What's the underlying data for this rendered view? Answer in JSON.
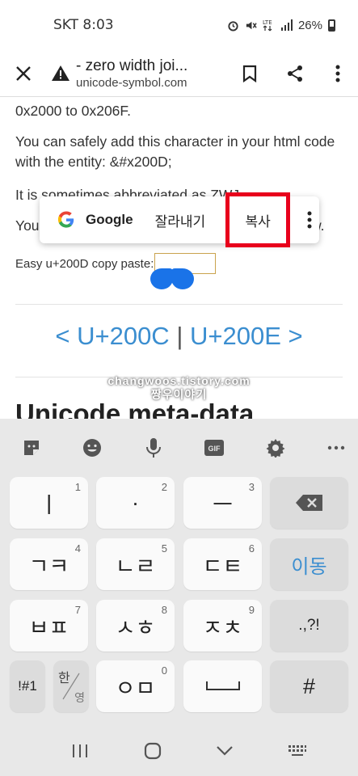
{
  "status_bar": {
    "carrier_time": "SKT 8:03",
    "battery_percent": "26%"
  },
  "toolbar": {
    "title": "- zero width joi...",
    "url": "unicode-symbol.com"
  },
  "page": {
    "range_text": "0x2000 to 0x206F.",
    "entity_text": "You can safely add this character in your html code with the entity: &#x200D;",
    "abbrev_text": "It is sometimes abbreviated as ZWJ",
    "you_text": "You",
    "w_text": "w.",
    "copy_paste_label": "Easy u+200D copy paste:",
    "prev_link": "<  U+200C",
    "nav_sep": "|",
    "next_link": "U+200E  >",
    "meta_heading": "Unicode meta-data"
  },
  "watermark": {
    "line1": "changwoos.tistory.com",
    "line2": "짱우이야기"
  },
  "selection_popup": {
    "google_label": "Google",
    "cut_label": "잘라내기",
    "copy_label": "복사",
    "highlight_color": "#e8001c"
  },
  "keyboard": {
    "tools": [
      "sticker-icon",
      "emoji-icon",
      "mic-icon",
      "gif-icon",
      "gear-icon",
      "more-icon"
    ],
    "gif_label": "GIF",
    "rows": [
      [
        {
          "label": "ㅣ",
          "num": "1"
        },
        {
          "label": "·",
          "num": "2"
        },
        {
          "label": "ㅡ",
          "num": "3"
        },
        {
          "label": "⌫",
          "num": ""
        }
      ],
      [
        {
          "label": "ㄱㅋ",
          "num": "4"
        },
        {
          "label": "ㄴㄹ",
          "num": "5"
        },
        {
          "label": "ㄷㅌ",
          "num": "6"
        },
        {
          "label": "이동",
          "num": ""
        }
      ],
      [
        {
          "label": "ㅂㅍ",
          "num": "7"
        },
        {
          "label": "ㅅㅎ",
          "num": "8"
        },
        {
          "label": "ㅈㅊ",
          "num": "9"
        },
        {
          "label": ".,?!",
          "num": ""
        }
      ],
      [
        {
          "label": "!#1",
          "num": ""
        },
        {
          "label": "한/영",
          "num": ""
        },
        {
          "label": "ㅇㅁ",
          "num": "0"
        },
        {
          "label": "⎵",
          "num": ""
        },
        {
          "label": "#",
          "num": ""
        }
      ]
    ],
    "hanyoung_top": "한",
    "hanyoung_bottom": "영"
  },
  "accent_color": "#3b8ed0"
}
